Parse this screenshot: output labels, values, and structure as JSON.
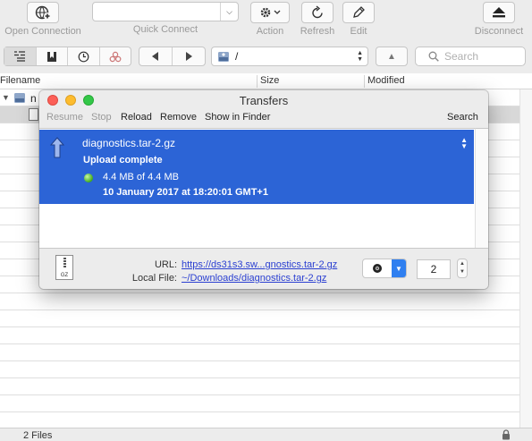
{
  "toolbar": {
    "open_connection": "Open Connection",
    "quick_connect": "Quick Connect",
    "quick_connect_value": "",
    "action": "Action",
    "refresh": "Refresh",
    "edit": "Edit",
    "disconnect": "Disconnect"
  },
  "navbar": {
    "path": "/",
    "search_placeholder": "Search"
  },
  "browser": {
    "columns": [
      "Filename",
      "Size",
      "Modified"
    ],
    "row_prefix": "n",
    "status": "2 Files"
  },
  "transfers": {
    "title": "Transfers",
    "toolbar": {
      "resume": "Resume",
      "stop": "Stop",
      "reload": "Reload",
      "remove": "Remove",
      "show_in_finder": "Show in Finder",
      "search": "Search"
    },
    "items": [
      {
        "filename": "diagnostics.tar-2.gz",
        "status": "Upload complete",
        "progress": "4.4 MB of 4.4 MB",
        "date": "10 January 2017 at 18:20:01 GMT+1",
        "direction": "upload"
      }
    ],
    "details": {
      "file_icon_label": "GZ",
      "url_label": "URL:",
      "url": "https://ds31s3.sw...gnostics.tar-2.gz",
      "local_label": "Local File:",
      "local_file": "~/Downloads/diagnostics.tar-2.gz",
      "connections": "2"
    }
  },
  "colors": {
    "selection": "#2c64d6",
    "link": "#2a3fd1",
    "close": "#fc5f57",
    "minimize": "#fdbc2e",
    "zoom": "#33c748",
    "status_ok": "#3faa1c"
  }
}
